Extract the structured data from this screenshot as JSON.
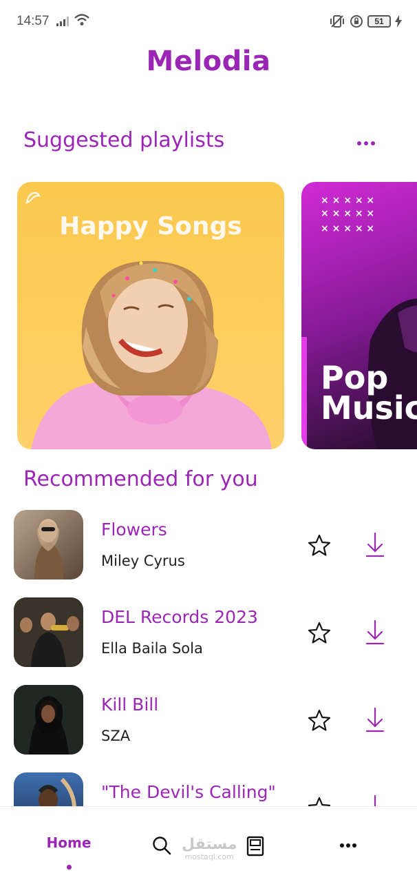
{
  "status_bar": {
    "time": "14:57",
    "battery": "51"
  },
  "app": {
    "title": "Melodia"
  },
  "suggested": {
    "title": "Suggested playlists",
    "playlists": [
      {
        "title": "Happy Songs"
      },
      {
        "title": "Pop\nMusic"
      }
    ]
  },
  "recommended": {
    "title": "Recommended for you",
    "songs": [
      {
        "title": "Flowers",
        "artist": "Miley Cyrus"
      },
      {
        "title": "DEL Records 2023",
        "artist": "Ella Baila Sola"
      },
      {
        "title": "Kill Bill",
        "artist": "SZA"
      },
      {
        "title": "\"The Devil's Calling\"",
        "artist": ""
      }
    ]
  },
  "bottom_nav": {
    "home_label": "Home"
  },
  "watermark": {
    "text": "مستقل",
    "sub": "mostaql.com"
  },
  "colors": {
    "accent": "#9b26b6"
  }
}
